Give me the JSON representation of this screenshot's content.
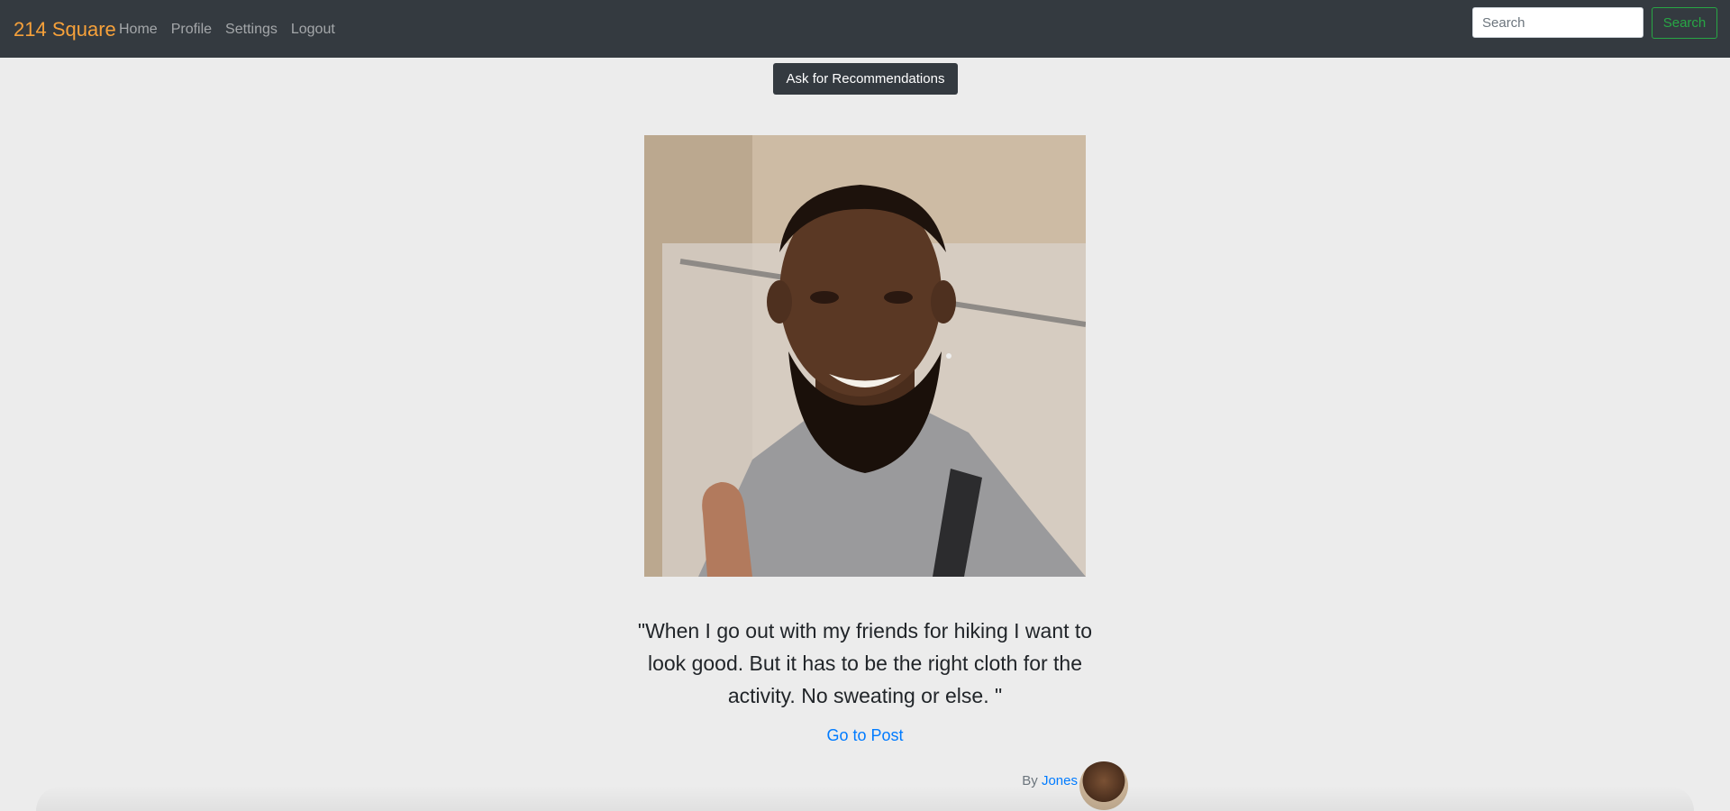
{
  "navbar": {
    "brand": "214 Square",
    "links": [
      "Home",
      "Profile",
      "Settings",
      "Logout"
    ],
    "search_placeholder": "Search",
    "search_button": "Search"
  },
  "actions": {
    "ask_recommendations": "Ask for Recommendations"
  },
  "post": {
    "quote": "\"When I go out with my friends for hiking I want to look good. But it has to be the right cloth for the activity. No sweating or else. \"",
    "go_to_post": "Go to Post",
    "by_label": "By",
    "author": "Jones"
  },
  "colors": {
    "navbar_bg": "#343a40",
    "brand": "#f7a13a",
    "link": "#007bff",
    "success": "#28a745",
    "page_bg": "#ececec"
  }
}
